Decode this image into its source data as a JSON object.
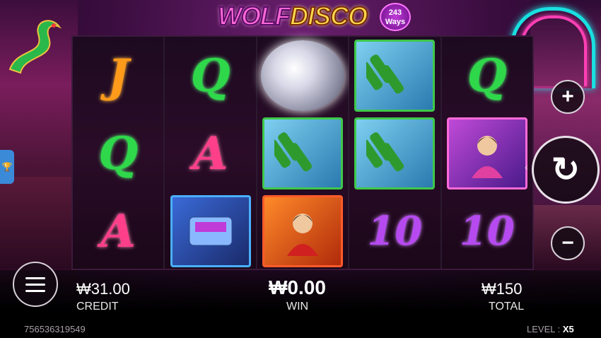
{
  "logo": {
    "wolf": "WOLF",
    "disco": "DISCO",
    "ways_number": "243",
    "ways_label": "Ways"
  },
  "reels": [
    [
      {
        "symbol": "J"
      },
      {
        "symbol": "Q"
      },
      {
        "symbol": "A"
      }
    ],
    [
      {
        "symbol": "Q"
      },
      {
        "symbol": "A"
      },
      {
        "symbol": "disco-pager"
      }
    ],
    [
      {
        "symbol": "disco-ball"
      },
      {
        "symbol": "beer-bottles"
      },
      {
        "symbol": "singer-man"
      }
    ],
    [
      {
        "symbol": "beer-bottles"
      },
      {
        "symbol": "beer-bottles"
      },
      {
        "symbol": "10"
      }
    ],
    [
      {
        "symbol": "Q"
      },
      {
        "symbol": "singer-woman"
      },
      {
        "symbol": "10"
      }
    ]
  ],
  "symbol_text": {
    "J": "J",
    "Q": "Q",
    "A": "A",
    "10": "10"
  },
  "controls": {
    "plus": "+",
    "minus": "−",
    "spin": "↻",
    "spin_arrow": "‹"
  },
  "status": {
    "credit_value": "₩31.00",
    "credit_label": "CREDIT",
    "win_value": "₩0.00",
    "win_label": "WIN",
    "total_value": "₩150",
    "total_label": "TOTAL"
  },
  "footer": {
    "account_id": "756536319549",
    "level_label": "LEVEL :",
    "level_value": "X5"
  },
  "colors": {
    "j": "#ff9a1a",
    "q": "#2fd84a",
    "a": "#ff3f8a",
    "ten": "#b64af0",
    "neon_cyan": "#19e0e0",
    "neon_pink": "#ff3fb4"
  }
}
